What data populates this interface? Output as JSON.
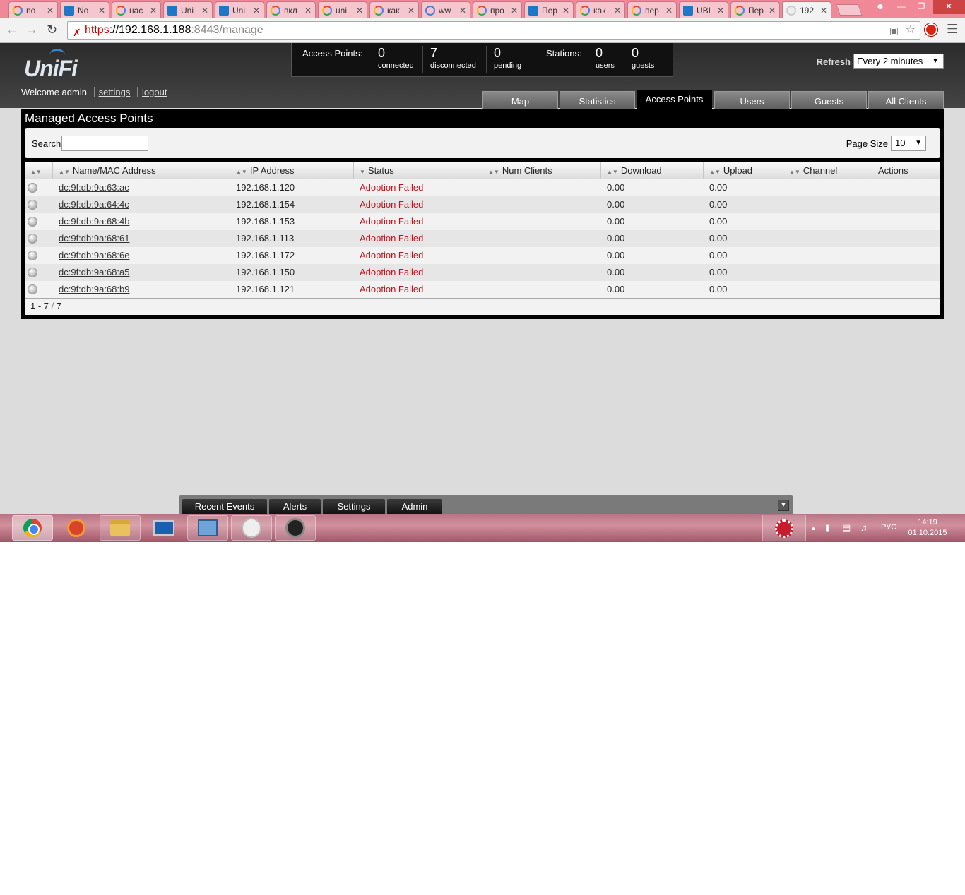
{
  "browser": {
    "tabs": [
      {
        "label": "no",
        "icon": "google-icon"
      },
      {
        "label": "No",
        "icon": "ubiquiti-icon"
      },
      {
        "label": "нас",
        "icon": "google-icon"
      },
      {
        "label": "Uni",
        "icon": "h-icon"
      },
      {
        "label": "Uni",
        "icon": "ubiquiti-icon"
      },
      {
        "label": "вкл",
        "icon": "google-icon"
      },
      {
        "label": "uni",
        "icon": "google-icon"
      },
      {
        "label": "как",
        "icon": "google-icon"
      },
      {
        "label": "ww",
        "icon": "site-icon"
      },
      {
        "label": "про",
        "icon": "google-icon"
      },
      {
        "label": "Пер",
        "icon": "translate-icon"
      },
      {
        "label": "как",
        "icon": "google-icon"
      },
      {
        "label": "пер",
        "icon": "google-icon"
      },
      {
        "label": "UBI",
        "icon": "ubiquiti-icon"
      },
      {
        "label": "Пер",
        "icon": "google-icon"
      },
      {
        "label": "192",
        "icon": "globe-icon"
      }
    ],
    "url_scheme": "https",
    "url_host": "://192.168.1.188",
    "url_port": ":8443",
    "url_path": "/manage"
  },
  "header": {
    "logo": "UniFi",
    "welcome": "Welcome admin",
    "settings_link": "settings",
    "logout_link": "logout",
    "refresh_link": "Refresh",
    "refresh_interval": "Every 2 minutes"
  },
  "summary": {
    "ap_label": "Access Points:",
    "connected": {
      "value": "0",
      "label": "connected"
    },
    "disconnected": {
      "value": "7",
      "label": "disconnected"
    },
    "pending": {
      "value": "0",
      "label": "pending"
    },
    "stations_label": "Stations:",
    "users": {
      "value": "0",
      "label": "users"
    },
    "guests": {
      "value": "0",
      "label": "guests"
    }
  },
  "nav_tabs": [
    "Map",
    "Statistics",
    "Access Points",
    "Users",
    "Guests",
    "All Clients"
  ],
  "panel": {
    "title": "Managed Access Points",
    "search_label": "Search",
    "search_value": "",
    "page_size_label": "Page Size",
    "page_size": "10"
  },
  "table": {
    "columns": [
      "Name/MAC Address",
      "IP Address",
      "Status",
      "Num Clients",
      "Download",
      "Upload",
      "Channel",
      "Actions"
    ],
    "rows": [
      {
        "mac": "dc:9f:db:9a:63:ac",
        "ip": "192.168.1.120",
        "status": "Adoption Failed",
        "clients": "",
        "download": "0.00",
        "upload": "0.00",
        "channel": ""
      },
      {
        "mac": "dc:9f:db:9a:64:4c",
        "ip": "192.168.1.154",
        "status": "Adoption Failed",
        "clients": "",
        "download": "0.00",
        "upload": "0.00",
        "channel": ""
      },
      {
        "mac": "dc:9f:db:9a:68:4b",
        "ip": "192.168.1.153",
        "status": "Adoption Failed",
        "clients": "",
        "download": "0.00",
        "upload": "0.00",
        "channel": ""
      },
      {
        "mac": "dc:9f:db:9a:68:61",
        "ip": "192.168.1.113",
        "status": "Adoption Failed",
        "clients": "",
        "download": "0.00",
        "upload": "0.00",
        "channel": ""
      },
      {
        "mac": "dc:9f:db:9a:68:6e",
        "ip": "192.168.1.172",
        "status": "Adoption Failed",
        "clients": "",
        "download": "0.00",
        "upload": "0.00",
        "channel": ""
      },
      {
        "mac": "dc:9f:db:9a:68:a5",
        "ip": "192.168.1.150",
        "status": "Adoption Failed",
        "clients": "",
        "download": "0.00",
        "upload": "0.00",
        "channel": ""
      },
      {
        "mac": "dc:9f:db:9a:68:b9",
        "ip": "192.168.1.121",
        "status": "Adoption Failed",
        "clients": "",
        "download": "0.00",
        "upload": "0.00",
        "channel": ""
      }
    ],
    "footer_range": "1 - 7",
    "footer_sep": "/",
    "footer_total": "7"
  },
  "dock": {
    "buttons": [
      "Recent Events",
      "Alerts",
      "Settings",
      "Admin"
    ]
  },
  "taskbar": {
    "apps": [
      "chrome-icon",
      "ccleaner-icon",
      "explorer-icon",
      "lenovo-icon",
      "control-panel-icon",
      "disc-icon",
      "unifi-ap-icon"
    ],
    "language": "РУС",
    "time": "14:19",
    "date": "01.10.2015"
  }
}
